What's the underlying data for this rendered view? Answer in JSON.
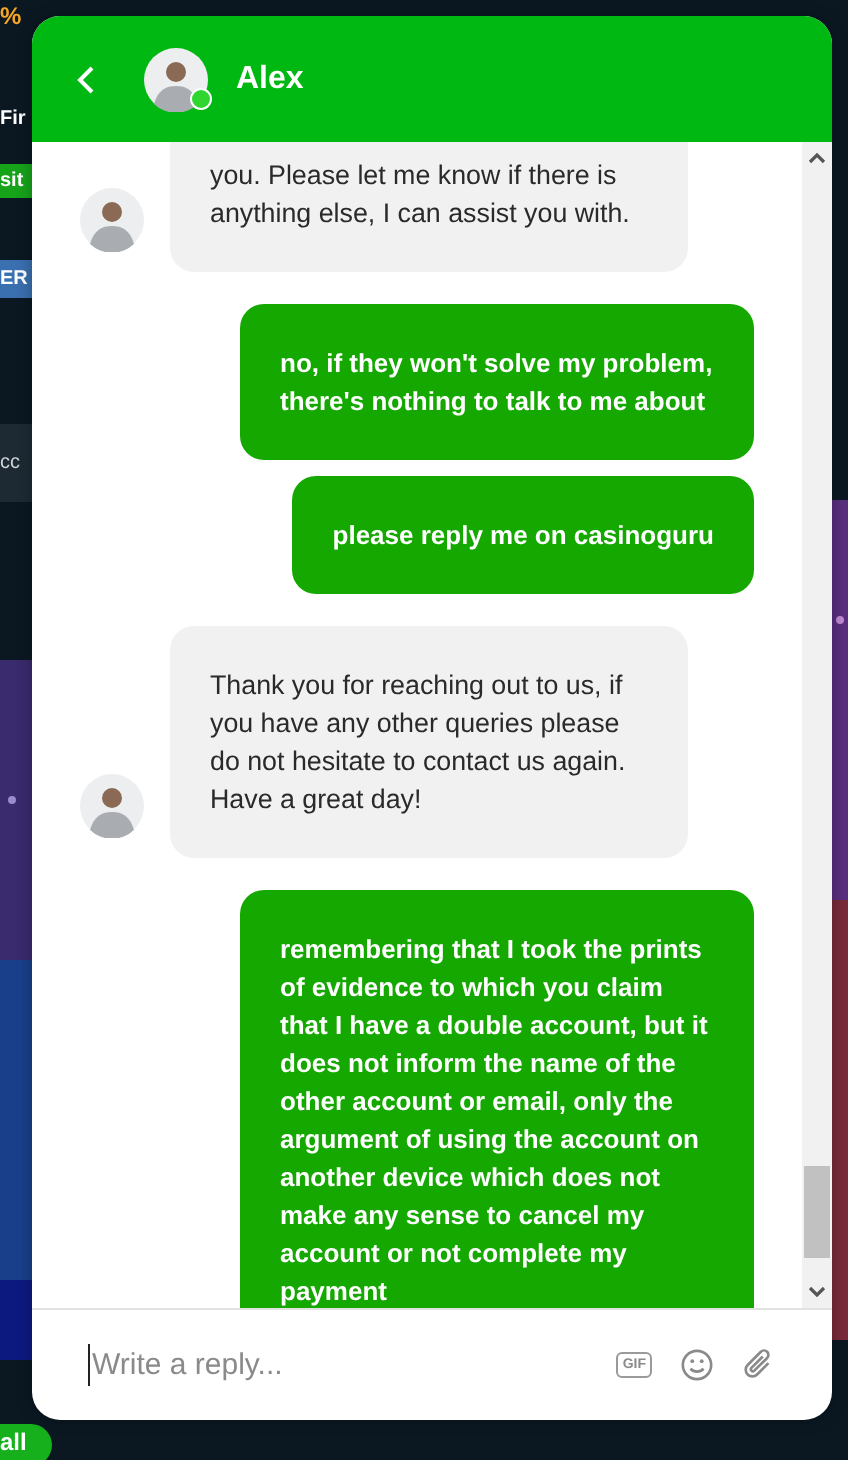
{
  "background": {
    "fragments": [
      {
        "kind": "promo",
        "text": "%"
      },
      {
        "kind": "heading",
        "text": "Fir"
      },
      {
        "kind": "green-button",
        "text": "sit"
      },
      {
        "kind": "blue-button",
        "text": "ER"
      },
      {
        "kind": "card",
        "text": "cc"
      },
      {
        "kind": "green-button-bottom",
        "text": "all"
      }
    ]
  },
  "header": {
    "contact": {
      "name": "Alex",
      "online": true
    }
  },
  "messages": [
    {
      "kind": "agent",
      "text": "you. Please let me know if there is anything else, I can assist you with.",
      "show_avatar": true
    },
    {
      "kind": "user",
      "text": "no, if they won't solve my problem, there's nothing to talk to me about"
    },
    {
      "kind": "user",
      "text": "please reply me on casinoguru"
    },
    {
      "kind": "agent",
      "text": "Thank you for reaching out to us, if you have any other queries please do not hesitate to contact us again. Have a great day!",
      "show_avatar": true
    },
    {
      "kind": "user",
      "text": "remembering that I took the prints of evidence to which you claim that I have a double account, but it does not inform the name of the other account or email, only the argument of using the account on another device which does not make any sense to cancel my account or not complete my payment"
    }
  ],
  "composer": {
    "placeholder": "Write a reply...",
    "gif_label": "GIF"
  }
}
